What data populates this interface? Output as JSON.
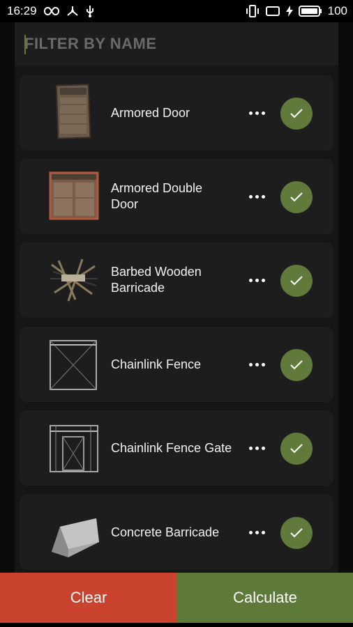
{
  "status_bar": {
    "time": "16:29",
    "battery": "100",
    "icons": [
      "infinity-icon",
      "usb-tether-icon",
      "usb-icon",
      "vibrate-icon",
      "screen-icon",
      "charging-icon",
      "battery-icon"
    ]
  },
  "filter": {
    "placeholder": "FILTER BY NAME",
    "value": ""
  },
  "items": [
    {
      "label": "Armored Door",
      "thumb": "armored-door",
      "checked": true
    },
    {
      "label": "Armored Double Door",
      "thumb": "armored-double-door",
      "checked": true
    },
    {
      "label": "Barbed Wooden Barricade",
      "thumb": "barbed-wooden-barricade",
      "checked": true
    },
    {
      "label": "Chainlink Fence",
      "thumb": "chainlink-fence",
      "checked": true
    },
    {
      "label": "Chainlink Fence Gate",
      "thumb": "chainlink-fence-gate",
      "checked": true
    },
    {
      "label": "Concrete Barricade",
      "thumb": "concrete-barricade",
      "checked": true
    }
  ],
  "buttons": {
    "clear": "Clear",
    "calculate": "Calculate"
  },
  "colors": {
    "accent_green": "#5f7a3a",
    "clear_red": "#c9432f",
    "background": "#0b0b0b",
    "card": "#1d1d1d"
  }
}
